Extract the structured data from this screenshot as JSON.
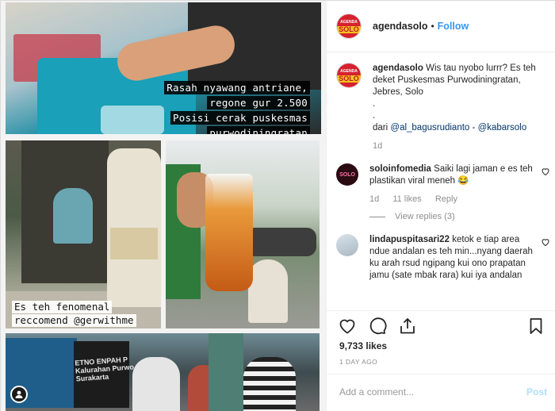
{
  "post": {
    "username": "agendasolo",
    "follow_label": "Follow",
    "header_separator": "•",
    "logo_top": "AGENDA",
    "logo_bottom": "SOLO",
    "photo_captions": {
      "top": [
        "Rasah nyawang antriane,",
        "regone gur 2.500",
        "Posisi cerak puskesmas",
        "purwodiningratan"
      ],
      "bottom": [
        "Es teh fenomenal",
        "reccomend @gerwithme"
      ],
      "banner": "ETNO ENPAH P\nKalurahan Purwo\nSurakarta"
    }
  },
  "caption": {
    "username": "agendasolo",
    "text": "Wis tau nyobo lurrr? Es teh deket Puskesmas Purwodiningratan, Jebres, Solo",
    "dots": [
      ".",
      "."
    ],
    "credit_prefix": "dari",
    "credit_mention1": "@al_bagusrudianto",
    "credit_sep": "-",
    "credit_mention2": "@kabarsolo",
    "age": "1d"
  },
  "comments": [
    {
      "username": "soloinfomedia",
      "text": "Saiki lagi jaman e es teh plastikan viral meneh 😂",
      "emoji_line": "😂",
      "age": "1d",
      "likes": "11 likes",
      "reply_label": "Reply",
      "view_replies": "View replies (3)",
      "avatar_text": "SOLO"
    },
    {
      "username": "lindapuspitasari22",
      "text": "ketok e tiap area ndue andalan es teh min...nyang daerah ku arah rsud ngipang kui ono prapatan jamu (sate mbak rara) kui iya andalan"
    }
  ],
  "engagement": {
    "likes": "9,733 likes",
    "ago": "1 DAY AGO"
  },
  "composer": {
    "placeholder": "Add a comment...",
    "post_label": "Post"
  },
  "colors": {
    "link": "#3897f0",
    "brand_red": "#d6212f",
    "post_disabled": "#b2dffc"
  }
}
